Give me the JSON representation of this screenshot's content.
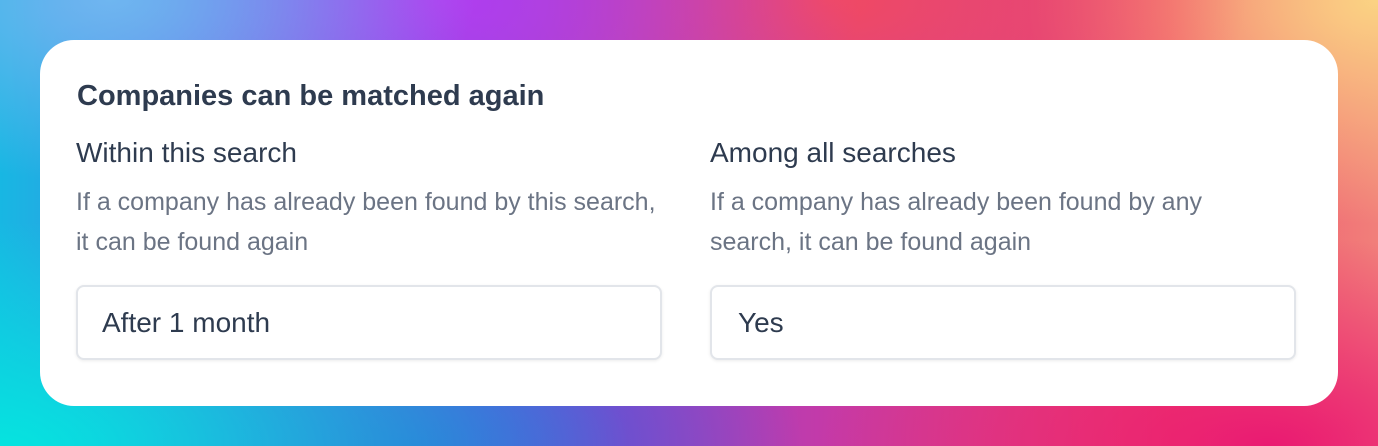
{
  "card": {
    "title": "Companies can be matched again"
  },
  "within_search": {
    "title": "Within this search",
    "description": "If a company has already been found by this search, it can be found again",
    "selected_value": "After 1 month"
  },
  "among_all": {
    "title": "Among all searches",
    "description": "If a company has already been found by any search, it can be found again",
    "selected_value": "Yes"
  },
  "colors": {
    "title_text": "#2e3b4f",
    "description_text": "#6b7484",
    "card_background": "#ffffff",
    "field_border": "#e2e5ea"
  }
}
